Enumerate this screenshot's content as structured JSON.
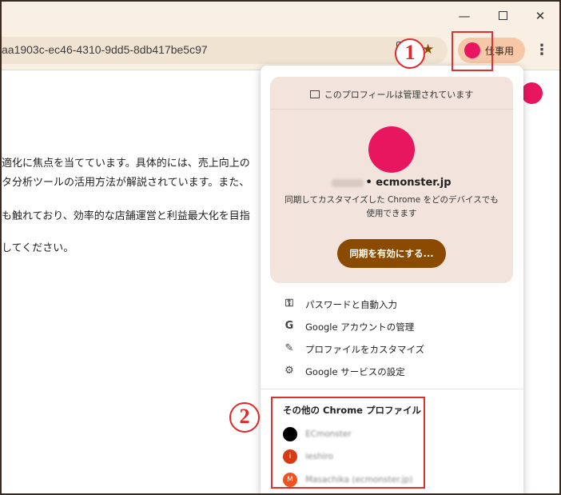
{
  "browser": {
    "url": "aa1903c-ec46-4310-9dd5-8db417be5c97",
    "window_controls": {
      "minimize": "—",
      "close": "✕"
    },
    "profile_chip_label": "仕事用",
    "menu_glyph": "⋮",
    "star_glyph": "★"
  },
  "annotations": {
    "badge_1": "1",
    "badge_2": "2"
  },
  "page": {
    "lines": [
      "適化に焦点を当てています。具体的には、売上向上の",
      "タ分析ツールの活用方法が解説されています。また、",
      "も触れており、効率的な店舗運営と利益最大化を目指",
      "",
      "してください。"
    ]
  },
  "profile_panel": {
    "managed_text": "このプロフィールは管理されています",
    "account_domain": "• ecmonster.jp",
    "sync_description_line1": "同期してカスタマイズした Chrome をどのデバイスでも",
    "sync_description_line2": "使用できます",
    "sync_button": "同期を有効にする...",
    "menu_items": [
      {
        "icon": "key-icon",
        "glyph": "⚿",
        "label": "パスワードと自動入力"
      },
      {
        "icon": "google-icon",
        "glyph": "G",
        "label": "Google アカウントの管理"
      },
      {
        "icon": "pencil-icon",
        "glyph": "✎",
        "label": "プロファイルをカスタマイズ"
      },
      {
        "icon": "gear-icon",
        "glyph": "⚙",
        "label": "Google サービスの設定"
      }
    ],
    "other_profiles_title": "その他の Chrome プロファイル",
    "other_profiles": [
      {
        "avatar_letter": "",
        "avatar_color": "#000000",
        "name": "ECmonster"
      },
      {
        "avatar_letter": "i",
        "avatar_color": "#d93a12",
        "name": "ieshiro"
      },
      {
        "avatar_letter": "M",
        "avatar_color": "#f0531f",
        "name": "Masachika (ecmonster.jp)"
      }
    ]
  },
  "colors": {
    "accent_brown": "#8a4a00",
    "avatar_pink": "#e8165f",
    "highlight_red": "#e03030"
  }
}
